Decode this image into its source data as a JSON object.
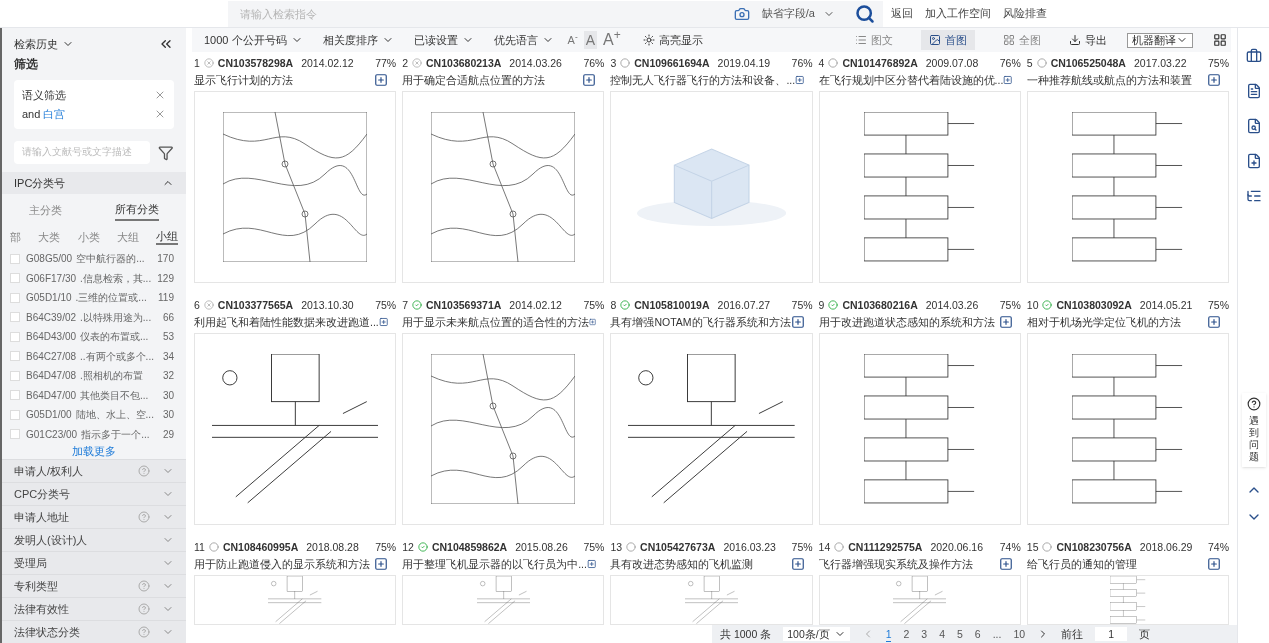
{
  "search": {
    "placeholder": "请输入检索指令",
    "field": "缺省字段/a"
  },
  "top_links": [
    "返回",
    "加入工作空间",
    "风险排查"
  ],
  "sidebar": {
    "history": "检索历史",
    "filter_title": "筛选",
    "filters": [
      {
        "kind": "label",
        "text": "语义筛选"
      },
      {
        "kind": "term",
        "prefix": "and",
        "text": "白宫"
      }
    ],
    "filter_input": {
      "placeholder": "请输入文献号或文字描述"
    },
    "ipc": {
      "title": "IPC分类号",
      "expanded": true,
      "tabs": [
        {
          "label": "主分类",
          "selected": false
        },
        {
          "label": "所有分类",
          "selected": true
        }
      ],
      "levels": [
        {
          "label": "部",
          "selected": false
        },
        {
          "label": "大类",
          "selected": false
        },
        {
          "label": "小类",
          "selected": false
        },
        {
          "label": "大组",
          "selected": false
        },
        {
          "label": "小组",
          "selected": true
        }
      ],
      "items": [
        {
          "code": "G08G5/00",
          "desc": "空中航行器的...",
          "count": "170",
          "checked": false
        },
        {
          "code": "G06F17/30",
          "desc": ".信息检索，其...",
          "count": "129",
          "checked": false
        },
        {
          "code": "G05D1/10",
          "desc": ".三维的位置或...",
          "count": "119",
          "checked": false
        },
        {
          "code": "B64C39/02",
          "desc": ".以特殊用途为...",
          "count": "66",
          "checked": false
        },
        {
          "code": "B64D43/00",
          "desc": "仪表的布置或...",
          "count": "53",
          "checked": false
        },
        {
          "code": "B64C27/08",
          "desc": "..有两个或多个...",
          "count": "34",
          "checked": false
        },
        {
          "code": "B64D47/08",
          "desc": ".照相机的布置",
          "count": "32",
          "checked": false
        },
        {
          "code": "B64D47/00",
          "desc": "其他类目不包...",
          "count": "30",
          "checked": false
        },
        {
          "code": "G05D1/00",
          "desc": "陆地、水上、空...",
          "count": "30",
          "checked": false
        },
        {
          "code": "G01C23/00",
          "desc": "指示多于一个...",
          "count": "29",
          "checked": false
        }
      ],
      "load_more": "加载更多"
    },
    "sections": [
      {
        "label": "申请人/权利人",
        "help": true,
        "expanded": false
      },
      {
        "label": "CPC分类号",
        "help": false,
        "expanded": false
      },
      {
        "label": "申请人地址",
        "help": true,
        "expanded": false
      },
      {
        "label": "发明人(设计)人",
        "help": false,
        "expanded": false
      },
      {
        "label": "受理局",
        "help": false,
        "expanded": false
      },
      {
        "label": "专利类型",
        "help": true,
        "expanded": false
      },
      {
        "label": "法律有效性",
        "help": true,
        "expanded": false
      },
      {
        "label": "法律状态分类",
        "help": true,
        "expanded": false
      }
    ]
  },
  "toolbar": {
    "menus": [
      "1000 个公开号码",
      "相关度排序",
      "已读设置",
      "优先语言"
    ],
    "font_sizes": [
      {
        "label": "A",
        "mark": "-",
        "selected": false
      },
      {
        "label": "A",
        "selected": true
      },
      {
        "label": "A",
        "mark": "+",
        "selected": false
      }
    ],
    "highlight": "高亮显示",
    "views": [
      {
        "label": "图文",
        "selected": false
      },
      {
        "label": "首图",
        "selected": true
      },
      {
        "label": "全图",
        "selected": false
      }
    ],
    "export": "导出",
    "translate": "机器翻译"
  },
  "results": [
    {
      "num": "1",
      "id": "CN103578298A",
      "date": "2014.02.12",
      "score": "77%",
      "title": "显示飞行计划的方法",
      "kind": "invalid",
      "figure": {
        "kind": "map"
      }
    },
    {
      "num": "2",
      "id": "CN103680213A",
      "date": "2014.03.26",
      "score": "76%",
      "title": "用于确定合适航点位置的方法",
      "kind": "invalid",
      "figure": {
        "kind": "map"
      }
    },
    {
      "num": "3",
      "id": "CN109661694A",
      "date": "2019.04.19",
      "score": "76%",
      "title": "控制无人飞行器飞行的方法和设备、...",
      "kind": "pending",
      "figure": {
        "kind": "empty"
      }
    },
    {
      "num": "4",
      "id": "CN101476892A",
      "date": "2009.07.08",
      "score": "76%",
      "title": "在飞行规划中区分替代着陆设施的优...",
      "kind": "pending",
      "figure": {
        "kind": "flowchart"
      }
    },
    {
      "num": "5",
      "id": "CN106525048A",
      "date": "2017.03.22",
      "score": "75%",
      "title": "一种推荐航线或航点的方法和装置",
      "kind": "pending",
      "figure": {
        "kind": "flowchart"
      }
    },
    {
      "num": "6",
      "id": "CN103377565A",
      "date": "2013.10.30",
      "score": "75%",
      "title": "利用起飞和着陆性能数据来改进跑道...",
      "kind": "invalid",
      "figure": {
        "kind": "schematic"
      }
    },
    {
      "num": "7",
      "id": "CN103569371A",
      "date": "2014.02.12",
      "score": "75%",
      "title": "用于显示未来航点位置的适合性的方法",
      "kind": "valid",
      "figure": {
        "kind": "map"
      }
    },
    {
      "num": "8",
      "id": "CN105810019A",
      "date": "2016.07.27",
      "score": "75%",
      "title": "具有增强NOTAM的飞行器系统和方法",
      "kind": "valid",
      "figure": {
        "kind": "schematic"
      }
    },
    {
      "num": "9",
      "id": "CN103680216A",
      "date": "2014.03.26",
      "score": "75%",
      "title": "用于改进跑道状态感知的系统和方法",
      "kind": "valid",
      "figure": {
        "kind": "flowchart"
      }
    },
    {
      "num": "10",
      "id": "CN103803092A",
      "date": "2014.05.21",
      "score": "75%",
      "title": "相对于机场光学定位飞机的方法",
      "kind": "valid",
      "figure": {
        "kind": "flowchart"
      }
    },
    {
      "num": "11",
      "id": "CN108460995A",
      "date": "2018.08.28",
      "score": "75%",
      "title": "用于防止跑道侵入的显示系统和方法",
      "kind": "pending",
      "figure": {
        "kind": "schematic"
      }
    },
    {
      "num": "12",
      "id": "CN104859862A",
      "date": "2015.08.26",
      "score": "75%",
      "title": "用于整理飞机显示器的以飞行员为中...",
      "kind": "valid",
      "figure": {
        "kind": "schematic"
      }
    },
    {
      "num": "13",
      "id": "CN105427673A",
      "date": "2016.03.23",
      "score": "75%",
      "title": "具有改进态势感知的飞机监测",
      "kind": "pending",
      "figure": {
        "kind": "schematic"
      }
    },
    {
      "num": "14",
      "id": "CN111292575A",
      "date": "2020.06.16",
      "score": "74%",
      "title": "飞行器增强现实系统及操作方法",
      "kind": "pending",
      "figure": {
        "kind": "schematic"
      }
    },
    {
      "num": "15",
      "id": "CN108230756A",
      "date": "2018.06.29",
      "score": "74%",
      "title": "给飞行员的通知的管理",
      "kind": "pending",
      "figure": {
        "kind": "flowchart"
      }
    }
  ],
  "pagination": {
    "total": "共 1000 条",
    "page_size": "100条/页",
    "pages": [
      {
        "label": "1",
        "selected": true
      },
      {
        "label": "2",
        "selected": false
      },
      {
        "label": "3",
        "selected": false
      },
      {
        "label": "4",
        "selected": false
      },
      {
        "label": "5",
        "selected": false
      },
      {
        "label": "6",
        "selected": false
      },
      {
        "label": "...",
        "selected": false
      },
      {
        "label": "10",
        "selected": false
      }
    ],
    "goto_label": "前往",
    "goto_value": "1",
    "goto_suffix": "页"
  },
  "help": {
    "text": "遇到问题"
  }
}
